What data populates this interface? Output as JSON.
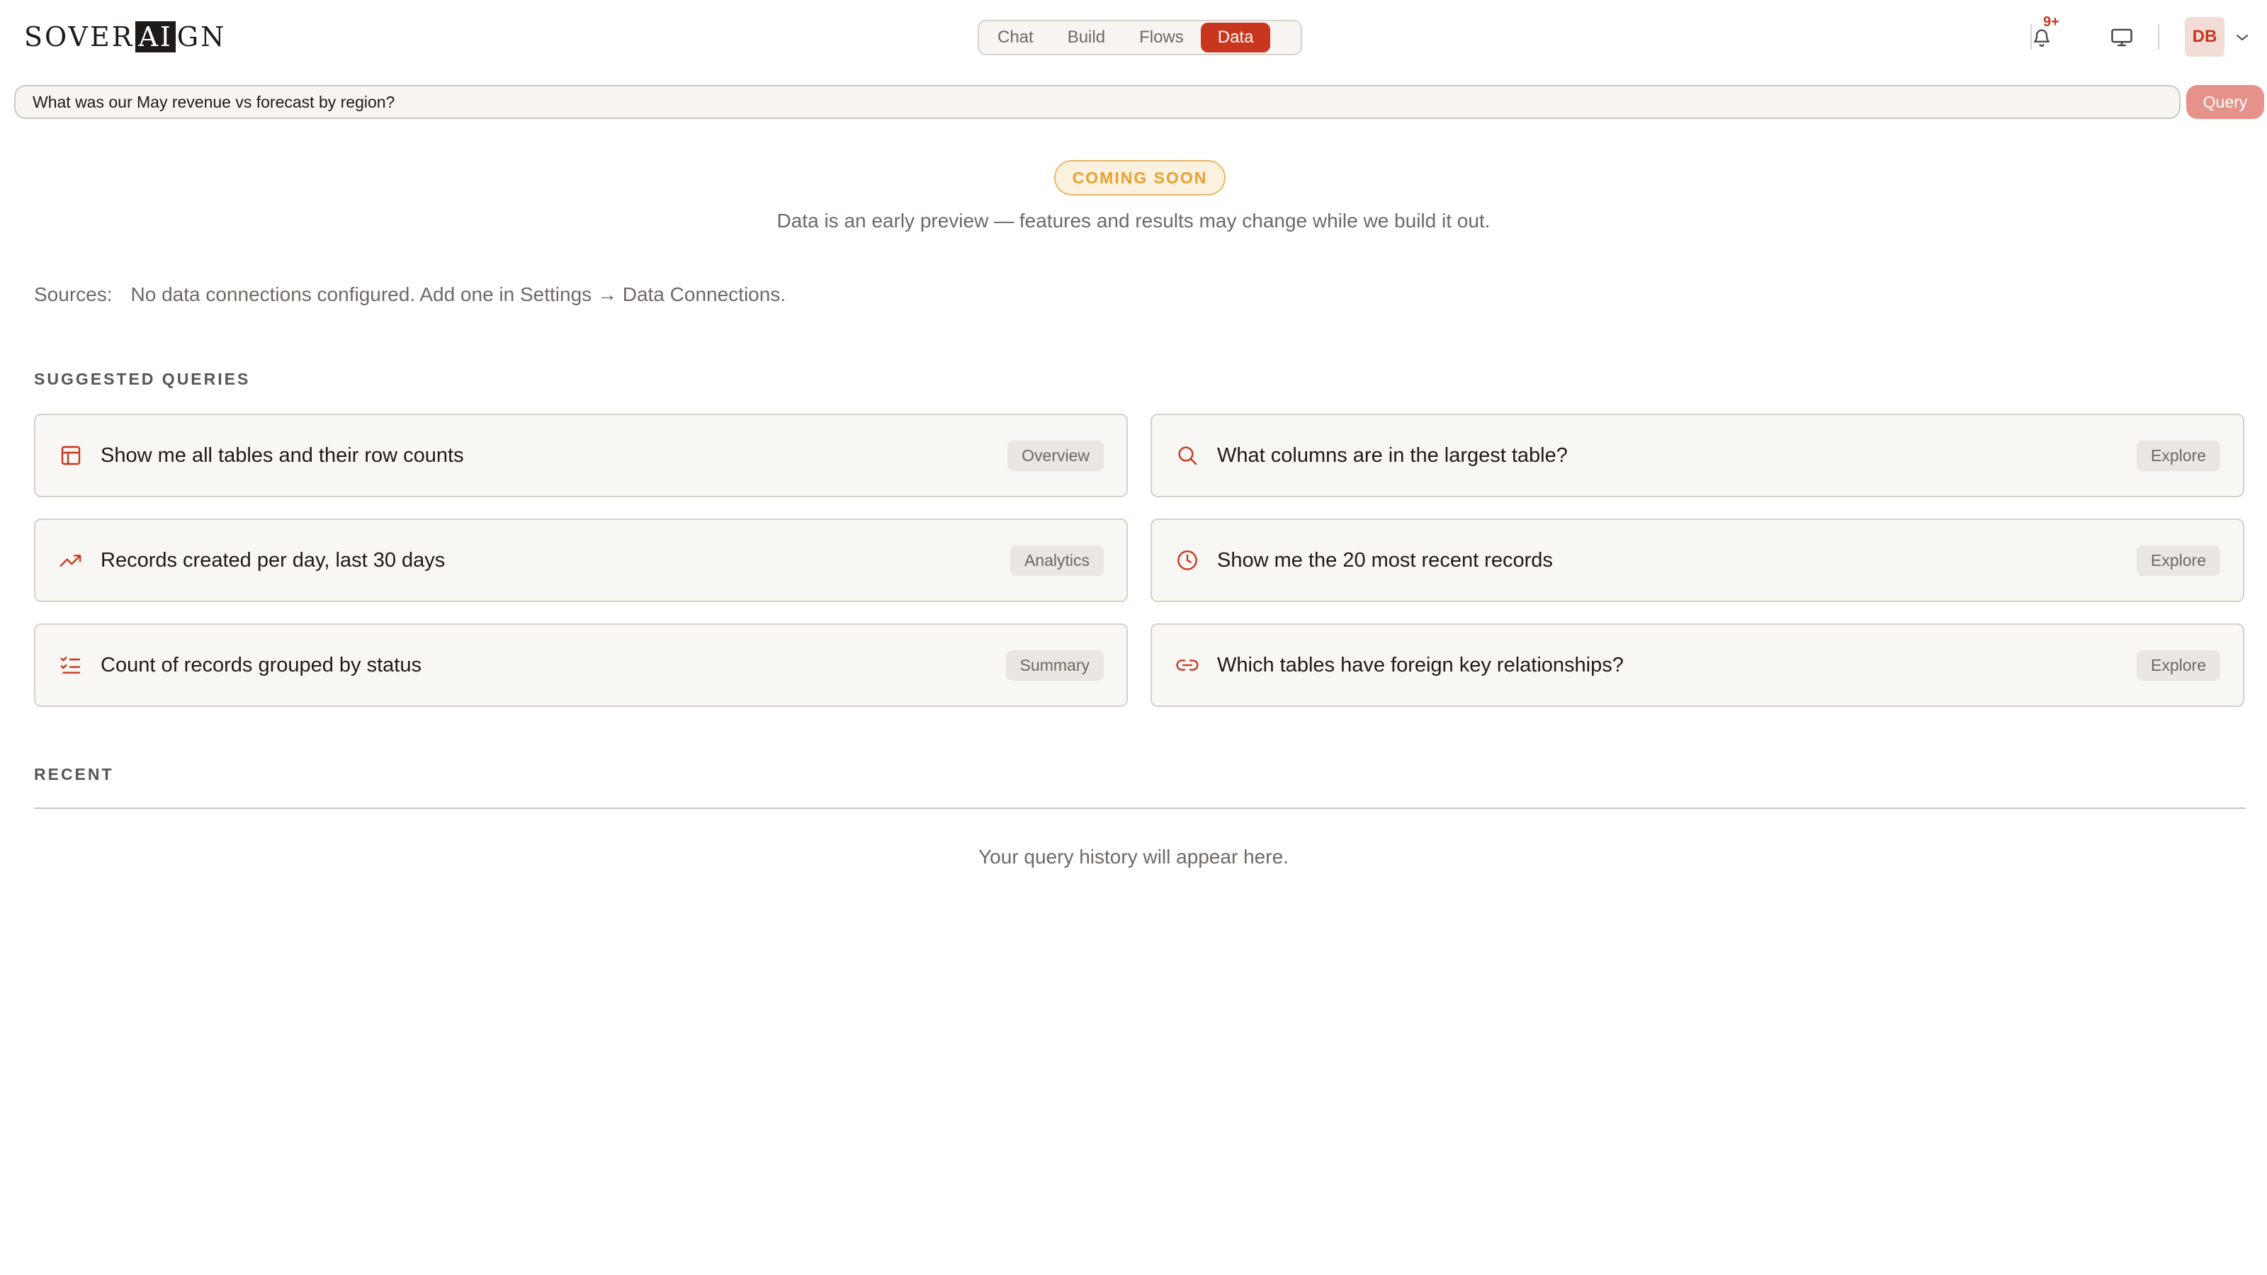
{
  "header": {
    "logo_pre": "SOVER",
    "logo_mark": "AI",
    "logo_post": "GN",
    "tabs": [
      {
        "label": "Chat",
        "active": false
      },
      {
        "label": "Build",
        "active": false
      },
      {
        "label": "Flows",
        "active": false
      },
      {
        "label": "Data",
        "active": true
      }
    ],
    "notifications_badge": "9+",
    "avatar_initials": "DB",
    "icons": [
      "bell-icon",
      "monitor-icon",
      "chevron-down-icon"
    ]
  },
  "query": {
    "value": "What was our May revenue vs forecast by region?",
    "button_label": "Query"
  },
  "banner": {
    "pill": "COMING SOON",
    "note": "Data is an early preview — features and results may change while we build it out."
  },
  "sources": {
    "label": "Sources:",
    "text": "No data connections configured. Add one in Settings → Data Connections."
  },
  "suggested": {
    "heading": "SUGGESTED QUERIES",
    "items": [
      {
        "icon": "table-icon",
        "text": "Show me all tables and their row counts",
        "tag": "Overview"
      },
      {
        "icon": "search-icon",
        "text": "What columns are in the largest table?",
        "tag": "Explore"
      },
      {
        "icon": "trending-up-icon",
        "text": "Records created per day, last 30 days",
        "tag": "Analytics"
      },
      {
        "icon": "clock-icon",
        "text": "Show me the 20 most recent records",
        "tag": "Explore"
      },
      {
        "icon": "checklist-icon",
        "text": "Count of records grouped by status",
        "tag": "Summary"
      },
      {
        "icon": "link-icon",
        "text": "Which tables have foreign key relationships?",
        "tag": "Explore"
      }
    ]
  },
  "recent": {
    "heading": "RECENT",
    "empty": "Your query history will appear here."
  },
  "colors": {
    "accent": "#c9361f",
    "accent_soft": "#e5938a",
    "warning": "#e8a130"
  }
}
